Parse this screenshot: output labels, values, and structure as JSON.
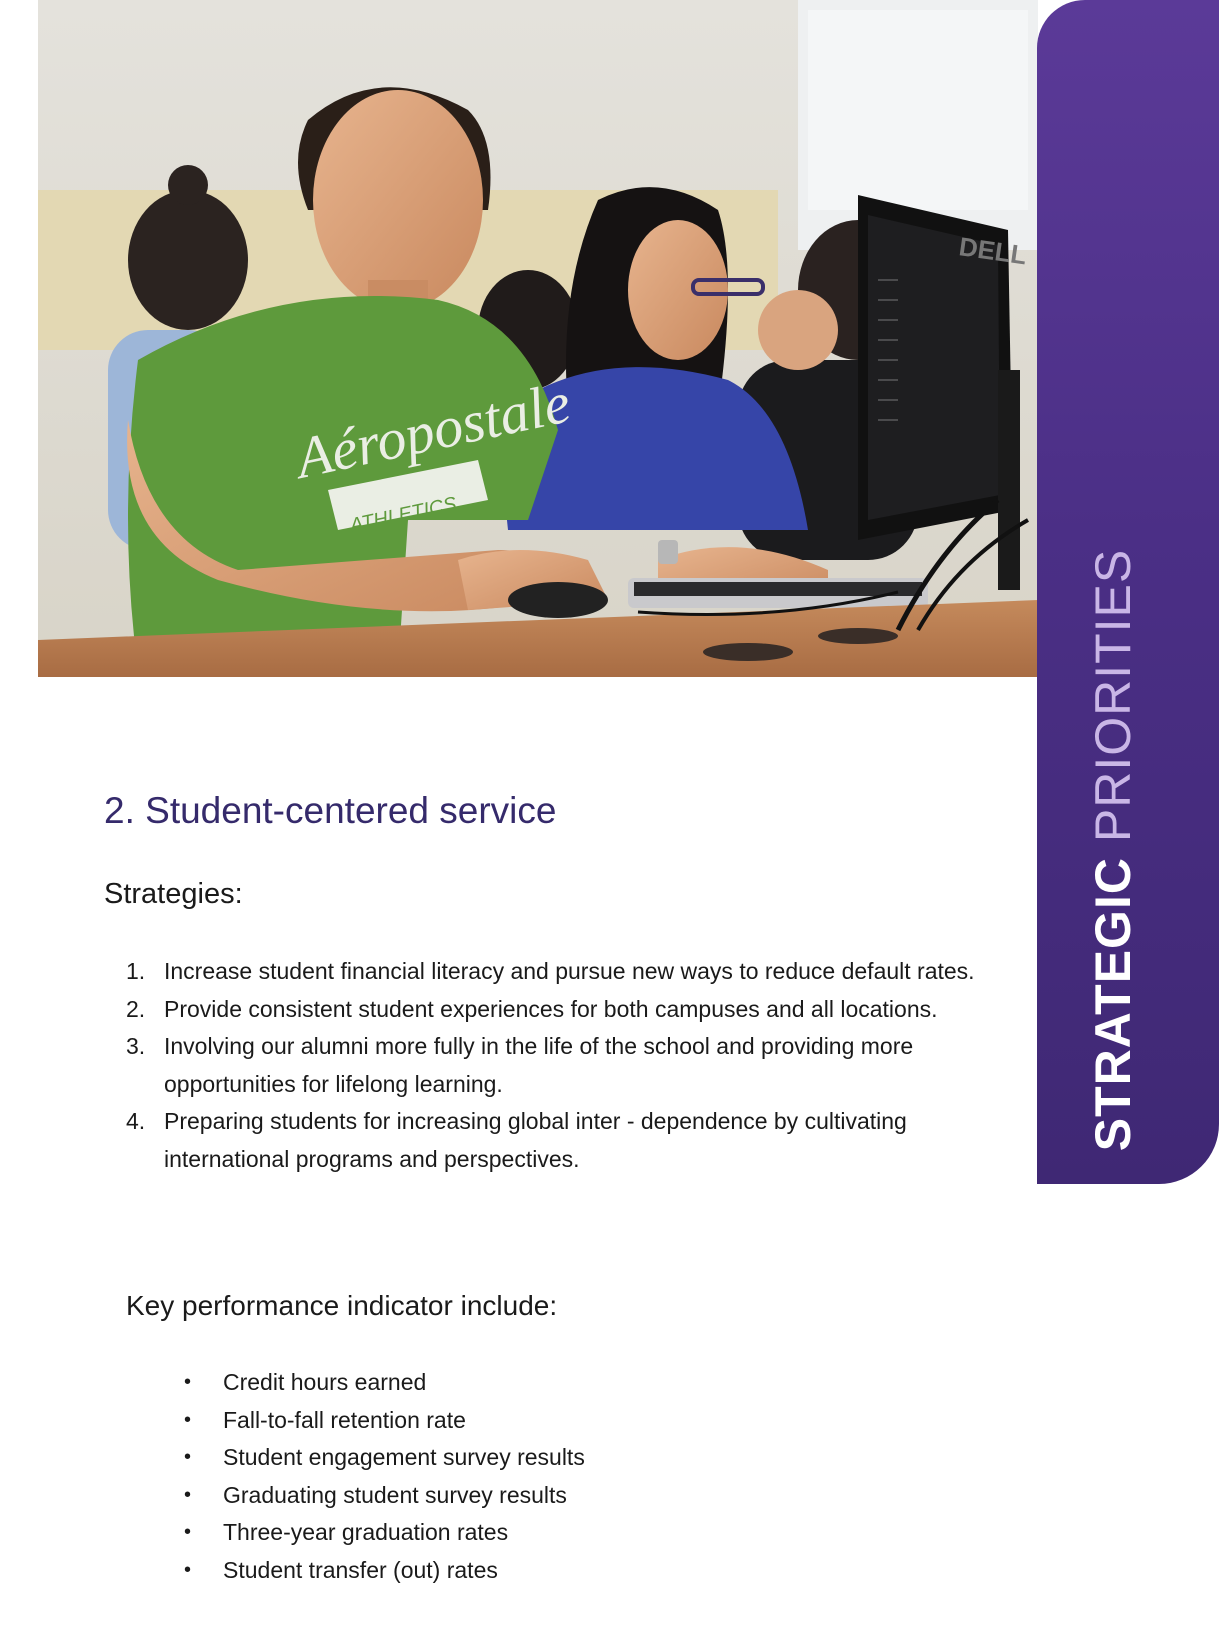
{
  "side_tab": {
    "word1": "STRATEGIC",
    "word2": "PRIORITIES"
  },
  "section": {
    "heading": "2. Student-centered service",
    "strategies_label": "Strategies:",
    "strategies": [
      {
        "num": "1.",
        "text": "Increase student financial literacy and pursue new ways to reduce default rates."
      },
      {
        "num": "2.",
        "text": "Provide consistent student experiences for both campuses and all locations."
      },
      {
        "num": "3.",
        "text": "Involving our alumni more fully in the life of the school and providing more opportunities for lifelong learning."
      },
      {
        "num": "4.",
        "text": "Preparing students for increasing global inter - dependence by cultivating international programs and perspectives."
      }
    ],
    "kpi_label": "Key performance indicator include:",
    "kpi_bullet": "•",
    "kpis": [
      "Credit hours earned",
      "Fall-to-fall retention rate",
      "Student engagement survey results",
      "Graduating student survey results",
      "Three-year graduation rates",
      "Student transfer (out) rates"
    ]
  },
  "photo": {
    "shirt_logo": "Aéropostale",
    "shirt_sub": "ATHLETICS",
    "monitor_brand": "DELL"
  },
  "colors": {
    "brand_purple": "#4b2f86",
    "heading": "#352a6b",
    "tab_secondary_text": "#c9b6e6"
  }
}
